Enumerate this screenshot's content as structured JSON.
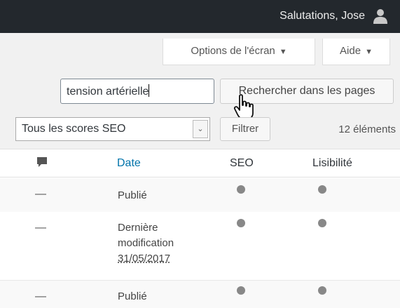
{
  "header": {
    "greeting": "Salutations, Jose",
    "user_icon": "user-icon"
  },
  "screen_options": {
    "label": "Options de l'écran",
    "caret": "▼"
  },
  "help": {
    "label": "Aide",
    "caret": "▼"
  },
  "search": {
    "value": "tension artérielle",
    "button_label": "Rechercher dans les pages"
  },
  "filters": {
    "seo_select_value": "Tous les scores SEO",
    "filter_button": "Filtrer",
    "item_count": "12 éléments"
  },
  "table": {
    "columns": {
      "date": "Date",
      "seo": "SEO",
      "readability": "Lisibilité"
    },
    "rows": [
      {
        "dash": "—",
        "status": "Publié",
        "date": ""
      },
      {
        "dash": "—",
        "status_line1": "Dernière",
        "status_line2": "modification",
        "date": "31/05/2017"
      },
      {
        "dash": "—",
        "status": "Publié",
        "date": ""
      }
    ]
  },
  "colors": {
    "admin_bar": "#23282d",
    "link": "#0073aa",
    "score_dot": "#888888"
  }
}
